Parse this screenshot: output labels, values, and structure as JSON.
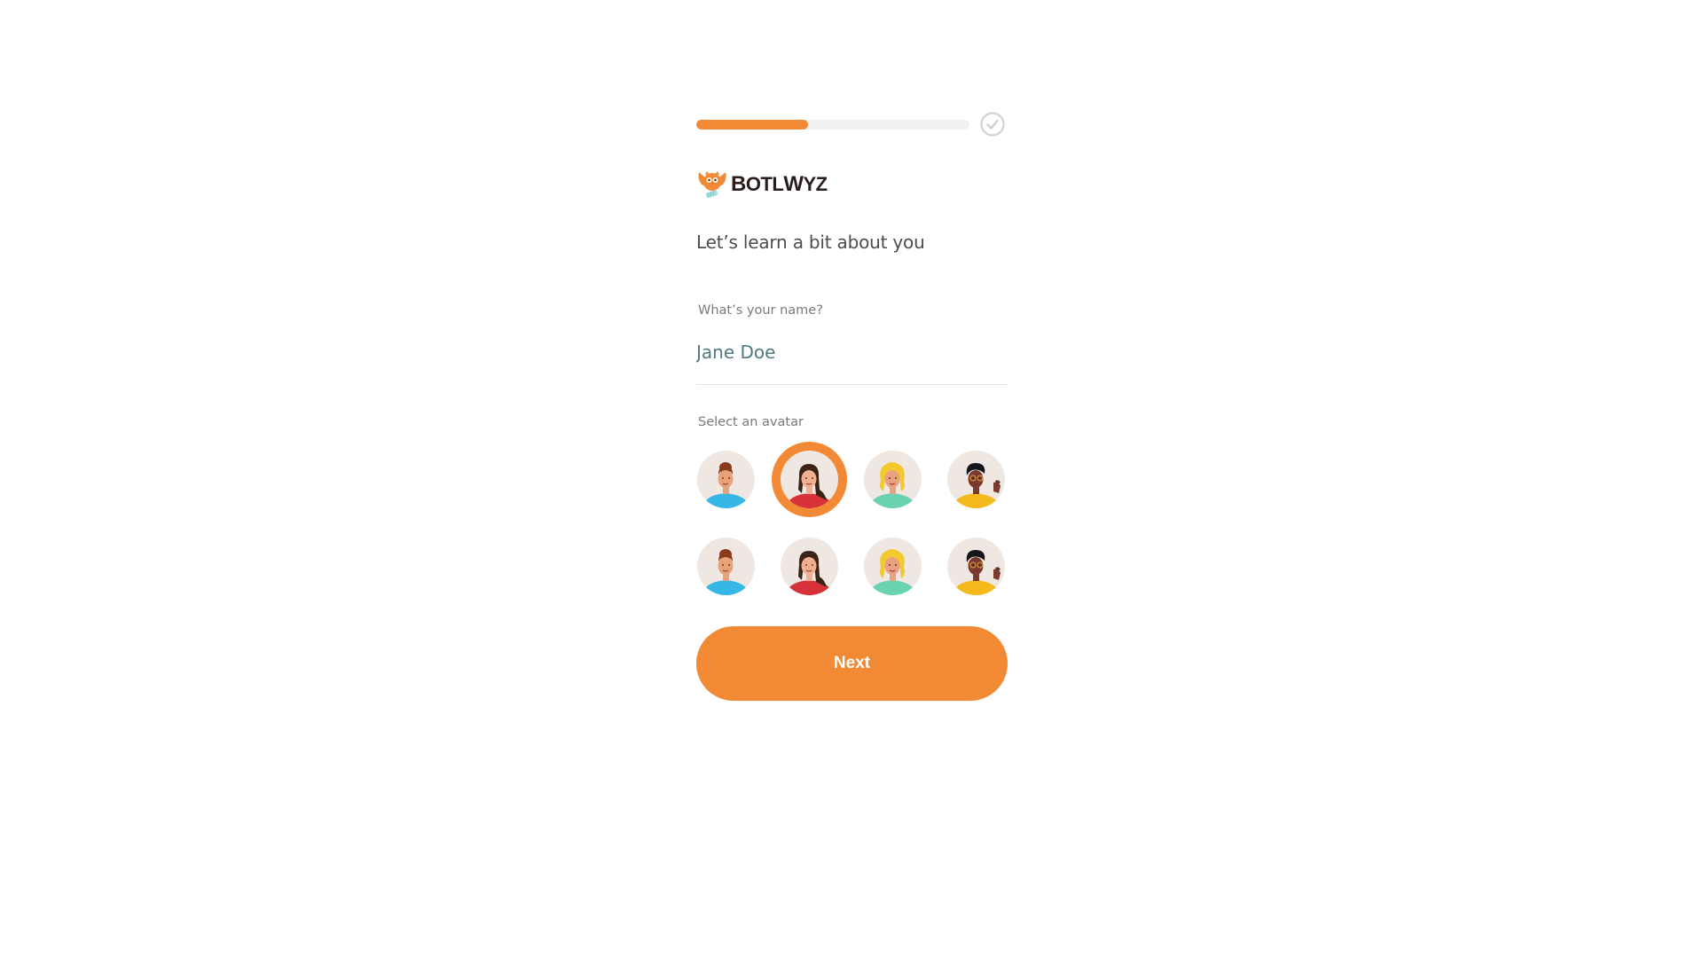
{
  "progress": {
    "value_percent": 41,
    "complete_icon": "check-circle-icon"
  },
  "brand": {
    "name_first": "B",
    "name_rest": "OTL",
    "name_w": "W",
    "name_end": "YZ",
    "full_name": "BotlWyz",
    "logo_icon": "owl-bottle-logo-icon"
  },
  "heading": "Let’s learn a bit about you",
  "name_field": {
    "label": "What’s your name?",
    "value": "Jane Doe"
  },
  "avatar_section": {
    "label": "Select an avatar",
    "selected_index": 1,
    "avatars": [
      {
        "name": "man-bun-blue-shirt",
        "skin": "#e7a27a",
        "hair": "#8a3a1e",
        "shirt": "#37b7e6",
        "hair_style": "bun"
      },
      {
        "name": "woman-long-hair-red-top",
        "skin": "#f0b090",
        "hair": "#3a2418",
        "shirt": "#d7323a",
        "hair_style": "long"
      },
      {
        "name": "woman-blonde-curly-mint-top",
        "skin": "#e9a27f",
        "hair": "#f2c92f",
        "shirt": "#69d2b0",
        "hair_style": "curly"
      },
      {
        "name": "man-glasses-yellow-shirt",
        "skin": "#7a3a2e",
        "hair": "#14161c",
        "shirt": "#f4b91c",
        "hair_style": "short"
      },
      {
        "name": "man-bun-blue-shirt",
        "skin": "#e7a27a",
        "hair": "#8a3a1e",
        "shirt": "#37b7e6",
        "hair_style": "bun"
      },
      {
        "name": "woman-long-hair-red-top",
        "skin": "#f0b090",
        "hair": "#3a2418",
        "shirt": "#d7323a",
        "hair_style": "long"
      },
      {
        "name": "woman-blonde-curly-mint-top",
        "skin": "#e9a27f",
        "hair": "#f2c92f",
        "shirt": "#69d2b0",
        "hair_style": "curly"
      },
      {
        "name": "man-glasses-yellow-shirt",
        "skin": "#7a3a2e",
        "hair": "#14161c",
        "shirt": "#f4b91c",
        "hair_style": "short"
      }
    ]
  },
  "next_button": {
    "label": "Next"
  },
  "colors": {
    "accent": "#f28a35",
    "track": "#f1f1f1",
    "name_text": "#4f7a80"
  }
}
